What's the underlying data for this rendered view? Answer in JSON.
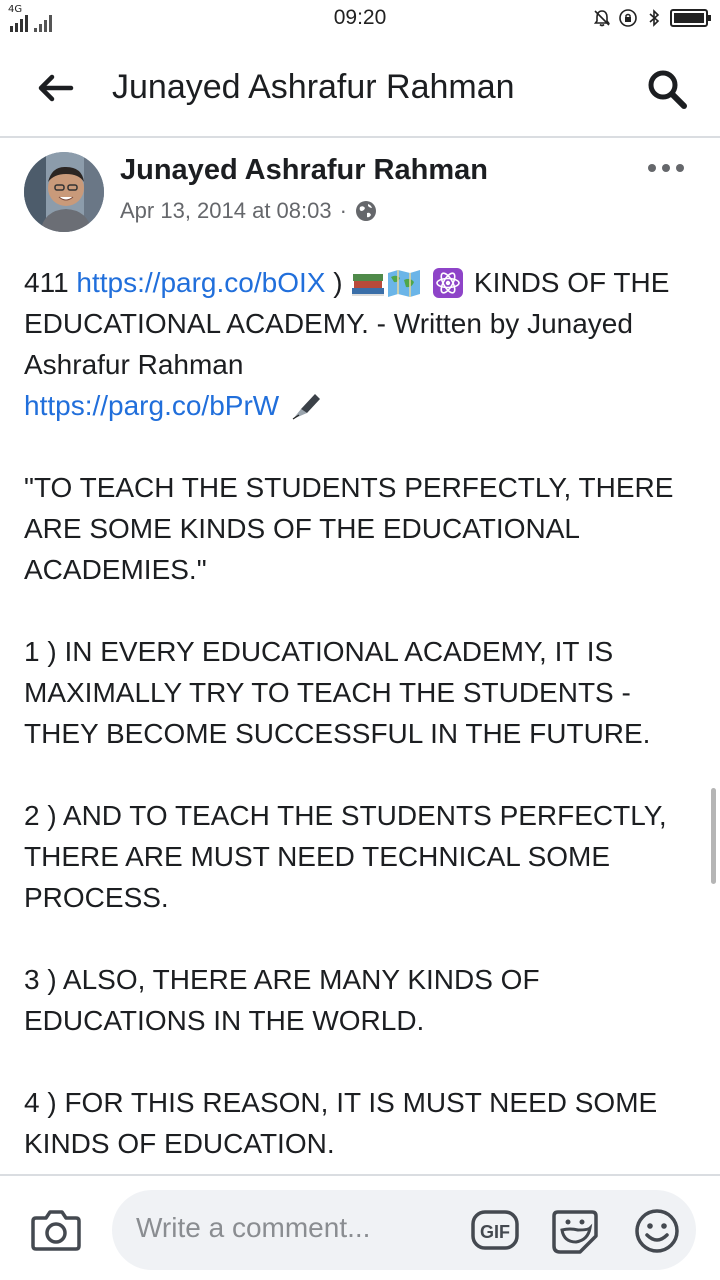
{
  "status_bar": {
    "network": "4G",
    "time": "09:20"
  },
  "header": {
    "title": "Junayed Ashrafur Rahman"
  },
  "post": {
    "author": "Junayed Ashrafur Rahman",
    "timestamp": "Apr 13, 2014 at 08:03",
    "separator": "·",
    "intro_number": "411",
    "link1": "https://parg.co/bOIX",
    "intro_close": ")",
    "intro_text": "KINDS OF THE EDUCATIONAL ACADEMY. - Written by Junayed Ashrafur Rahman",
    "link2": "https://parg.co/bPrW",
    "quote": "\"TO TEACH THE STUDENTS PERFECTLY, THERE ARE SOME KINDS OF THE EDUCATIONAL ACADEMIES.\"",
    "points": [
      "1 ) IN EVERY EDUCATIONAL ACADEMY, IT IS MAXIMALLY TRY TO TEACH THE STUDENTS - THEY BECOME SUCCESSFUL IN THE FUTURE.",
      "2 ) AND TO TEACH THE STUDENTS PERFECTLY, THERE ARE MUST NEED TECHNICAL SOME PROCESS.",
      "3 ) ALSO, THERE ARE MANY KINDS OF EDUCATIONS IN THE WORLD.",
      "4 ) FOR THIS REASON, IT IS MUST NEED SOME KINDS OF EDUCATION."
    ]
  },
  "comment_bar": {
    "placeholder": "Write a comment...",
    "gif_label": "GIF"
  },
  "colors": {
    "link": "#216fdb",
    "text": "#1c1e21",
    "muted": "#65676b",
    "input_bg": "#f0f2f5"
  },
  "icons": {
    "back": "arrow-left-icon",
    "search": "search-icon",
    "more": "more-dots-icon",
    "privacy": "globe-icon",
    "camera": "camera-icon",
    "sticker": "sticker-icon",
    "emoji": "smiley-icon"
  }
}
